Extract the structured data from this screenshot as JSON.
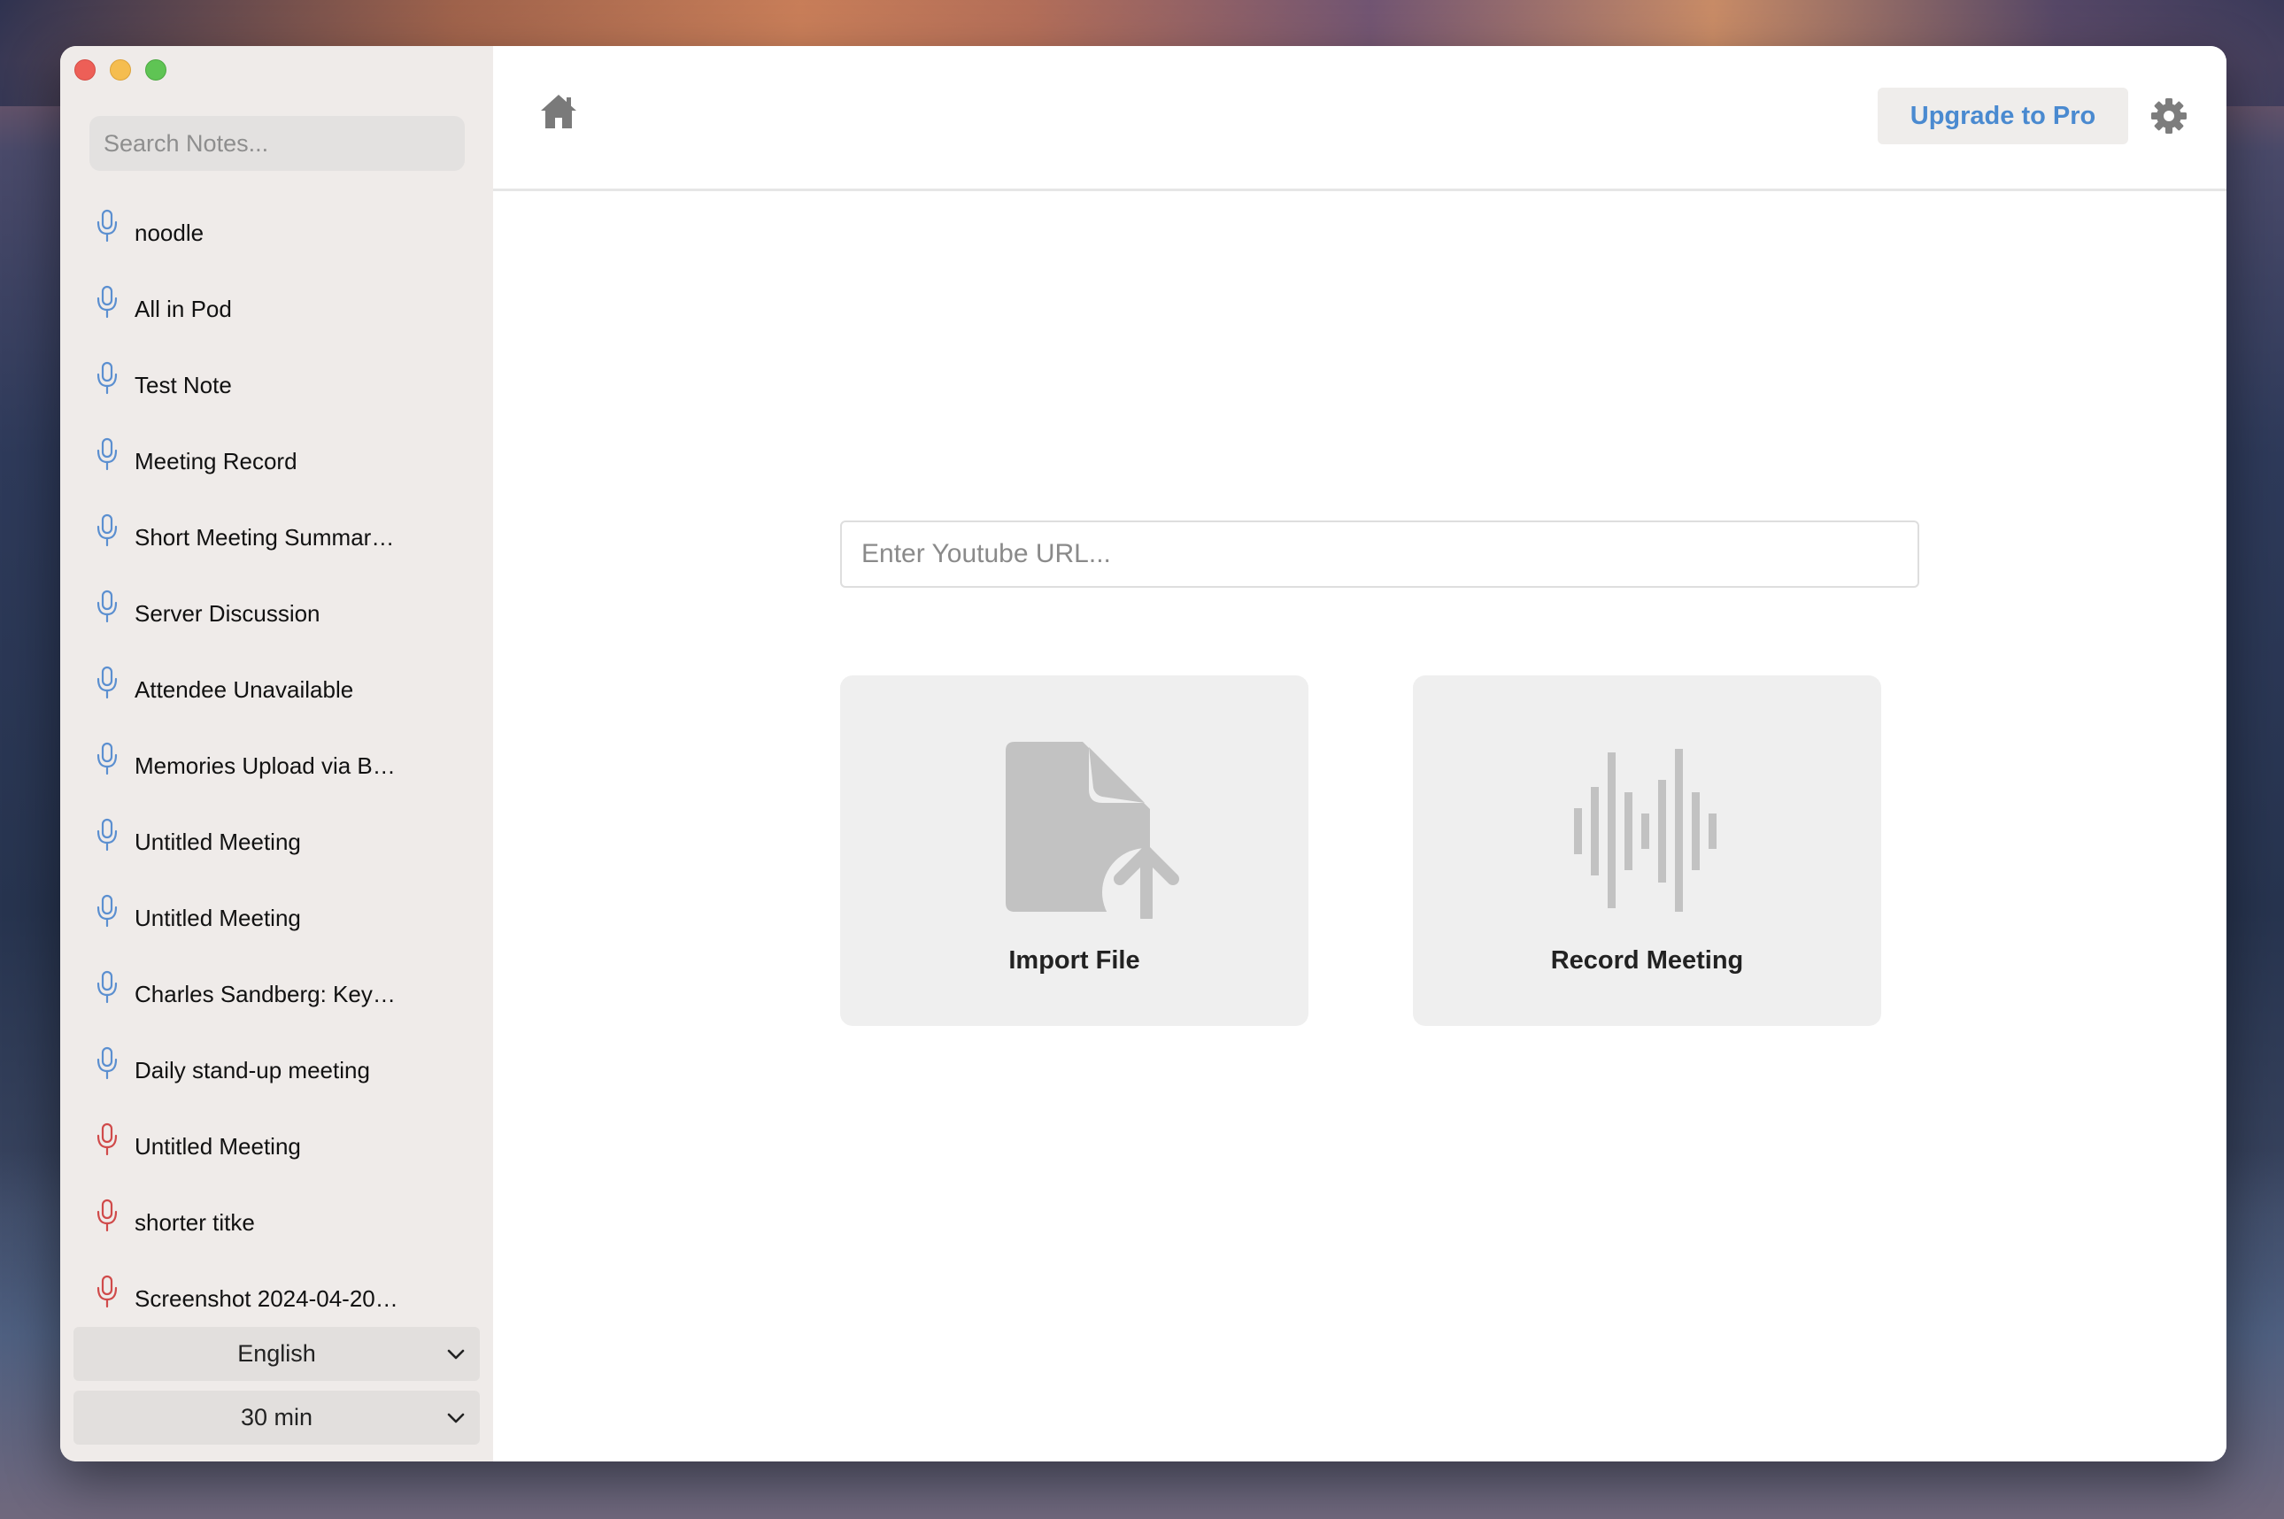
{
  "window": {
    "traffic_lights": [
      "close",
      "minimize",
      "maximize"
    ]
  },
  "sidebar": {
    "search_placeholder": "Search Notes...",
    "notes": [
      {
        "title": "noodle",
        "mic_color": "blue"
      },
      {
        "title": "All in Pod",
        "mic_color": "blue"
      },
      {
        "title": "Test Note",
        "mic_color": "blue"
      },
      {
        "title": "Meeting Record",
        "mic_color": "blue"
      },
      {
        "title": "Short Meeting Summar…",
        "mic_color": "blue"
      },
      {
        "title": "Server Discussion",
        "mic_color": "blue"
      },
      {
        "title": "Attendee Unavailable",
        "mic_color": "blue"
      },
      {
        "title": "Memories Upload via B…",
        "mic_color": "blue"
      },
      {
        "title": "Untitled Meeting",
        "mic_color": "blue"
      },
      {
        "title": "Untitled Meeting",
        "mic_color": "blue"
      },
      {
        "title": "Charles Sandberg: Key…",
        "mic_color": "blue"
      },
      {
        "title": "Daily stand-up meeting",
        "mic_color": "blue"
      },
      {
        "title": "Untitled Meeting",
        "mic_color": "red"
      },
      {
        "title": "shorter titke",
        "mic_color": "red"
      },
      {
        "title": "Screenshot 2024-04-20…",
        "mic_color": "red"
      }
    ],
    "language_select": {
      "value": "English"
    },
    "duration_select": {
      "value": "30 min"
    }
  },
  "header": {
    "home_icon": "home-icon",
    "upgrade_label": "Upgrade to Pro",
    "settings_icon": "gear-icon"
  },
  "main": {
    "url_placeholder": "Enter Youtube URL...",
    "import_card": {
      "label": "Import File",
      "icon": "file-upload-icon"
    },
    "record_card": {
      "label": "Record Meeting",
      "icon": "audio-waveform-icon"
    }
  },
  "colors": {
    "accent": "#4a8ad0",
    "mic_blue": "#5b8fd0",
    "mic_red": "#d04a4a",
    "sidebar_bg": "#efebe9",
    "card_bg": "#efefef",
    "icon_gray": "#c0c0c0"
  }
}
